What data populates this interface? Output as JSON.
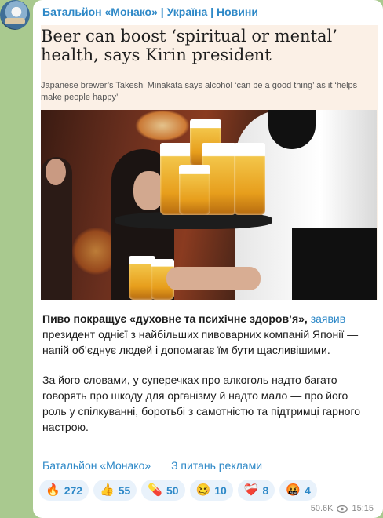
{
  "header": {
    "channel": "Батальйон «Монако» | Україна | Новини"
  },
  "article": {
    "title": "Beer can boost ‘spiritual or mental’ health, says Kirin president",
    "subtitle": "Japanese brewer’s Takeshi Minakata says alcohol ‘can be a good thing’ as it ‘helps make people happy’"
  },
  "post": {
    "p1_bold": "Пиво покращує «духовне та психічне здоров’я»,",
    "p1_link": "заявив",
    "p1_rest": "президент однієї з найбільших пивоварних компаній Японії — напій об’єднує людей і допомагає їм бути щасливішими.",
    "p2": "За його словами, у суперечках про алкоголь надто багато говорять про шкоду для організму й надто мало — про його роль у спілкуванні, боротьбі з самотністю та підтримці гарного настрою."
  },
  "signature": {
    "channel_link": "Батальйон «Монако»",
    "ads_link": "З питань реклами"
  },
  "reactions": [
    {
      "emoji": "🔥",
      "icon": "fire-icon",
      "count": "272"
    },
    {
      "emoji": "👍",
      "icon": "thumbs-up-icon",
      "count": "55"
    },
    {
      "emoji": "💊",
      "icon": "pill-icon",
      "count": "50"
    },
    {
      "emoji": "🥴",
      "icon": "woozy-face-icon",
      "count": "10"
    },
    {
      "emoji": "❤‍🩹",
      "icon": "mending-heart-icon",
      "count": "8"
    },
    {
      "emoji": "🤬",
      "icon": "cursing-face-icon",
      "count": "4"
    }
  ],
  "meta": {
    "views": "50.6K",
    "time": "15:15"
  },
  "colors": {
    "link": "#2d88c7",
    "reaction_bg": "#e9f2fb",
    "background": "#a9c98f"
  }
}
